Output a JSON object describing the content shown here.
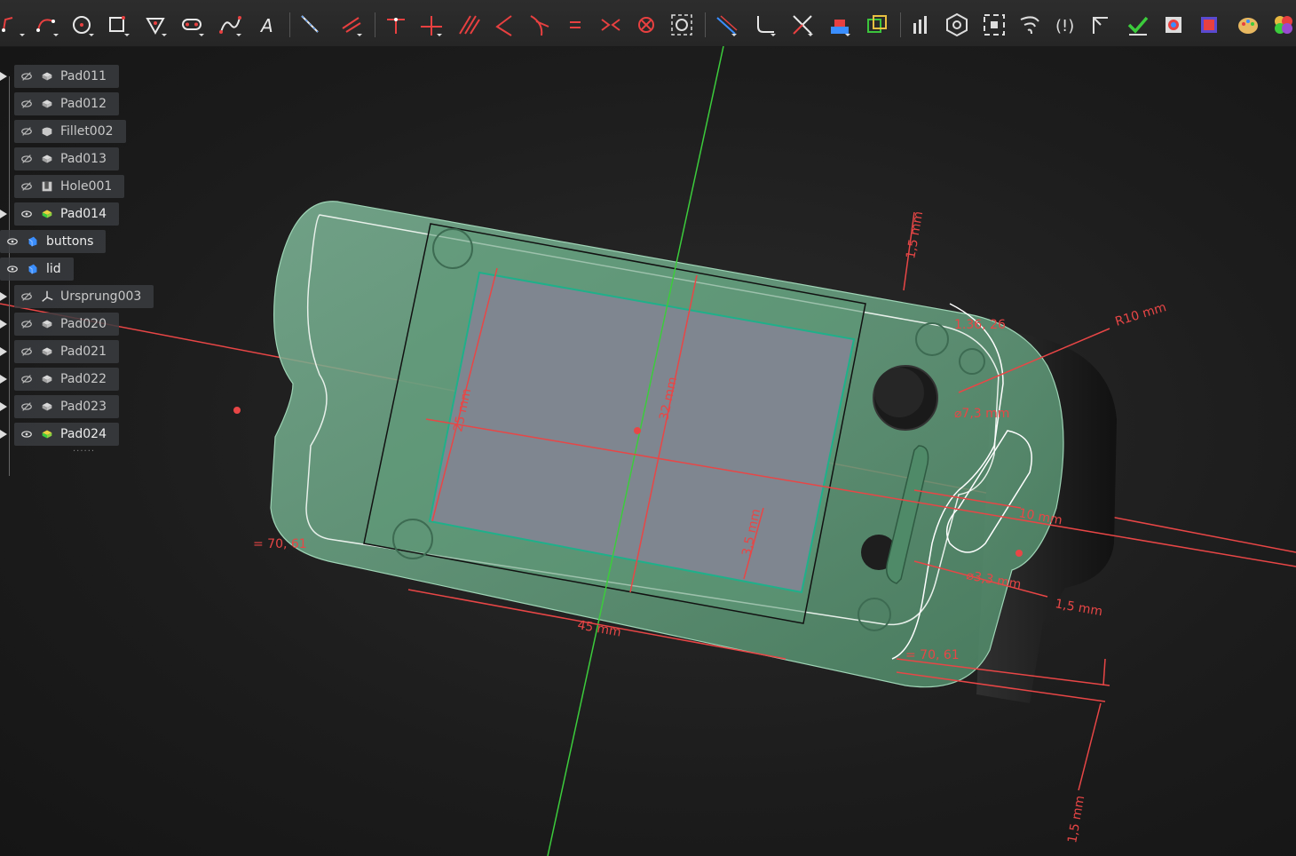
{
  "toolbar": {
    "tools": [
      {
        "name": "polyline-tool",
        "color": "#e84040"
      },
      {
        "name": "arc-tool",
        "color": "#e84040"
      },
      {
        "name": "circle-tool",
        "color": "#e84040"
      },
      {
        "name": "rectangle-tool",
        "color": "#e84040"
      },
      {
        "name": "polygon-tool",
        "color": "#e84040"
      },
      {
        "name": "slot-tool",
        "color": "#e84040"
      },
      {
        "name": "bspline-tool",
        "color": "#e84040"
      },
      {
        "name": "text-tool",
        "color": "#e8e8e8",
        "glyph": "A"
      },
      {
        "name": "line-tool",
        "color": "#e84040"
      },
      {
        "name": "trim-tool",
        "color": "#e84040"
      }
    ]
  },
  "tree": {
    "items": [
      {
        "label": "Pad011",
        "visible": false,
        "icon": "pad",
        "expandable": true
      },
      {
        "label": "Pad012",
        "visible": false,
        "icon": "pad",
        "expandable": false
      },
      {
        "label": "Fillet002",
        "visible": false,
        "icon": "fillet",
        "expandable": false
      },
      {
        "label": "Pad013",
        "visible": false,
        "icon": "pad",
        "expandable": false
      },
      {
        "label": "Hole001",
        "visible": false,
        "icon": "hole",
        "expandable": false
      },
      {
        "label": "Pad014",
        "visible": true,
        "icon": "pad-active",
        "expandable": true
      },
      {
        "label": "buttons",
        "visible": true,
        "icon": "body",
        "expandable": false,
        "root": true
      },
      {
        "label": "lid",
        "visible": true,
        "icon": "body",
        "expandable": false,
        "root": true
      },
      {
        "label": "Ursprung003",
        "visible": false,
        "icon": "origin",
        "expandable": true
      },
      {
        "label": "Pad020",
        "visible": false,
        "icon": "pad",
        "expandable": true
      },
      {
        "label": "Pad021",
        "visible": false,
        "icon": "pad",
        "expandable": true
      },
      {
        "label": "Pad022",
        "visible": false,
        "icon": "pad",
        "expandable": true
      },
      {
        "label": "Pad023",
        "visible": false,
        "icon": "pad",
        "expandable": true
      },
      {
        "label": "Pad024",
        "visible": true,
        "icon": "pad-active",
        "expandable": true
      }
    ],
    "ellipsis": "......"
  },
  "dimensions": {
    "top_thickness": "1,5 mm",
    "radius": "R10 mm",
    "angle_top": "1.36, 26",
    "hole_dia_top": "⌀7,3 mm",
    "width_25": "25 mm",
    "height_32": "32 mm",
    "offset_3_5": "3,5 mm",
    "length_45": "45 mm",
    "ten": "10 mm",
    "hole_dia_bottom": "⌀3,3 mm",
    "side_thickness": "1,5 mm",
    "bottom_thickness": "1,5 mm",
    "equal_left": "= 70, 61",
    "equal_right": "= 70, 61"
  },
  "colors": {
    "accent_red": "#e84646",
    "axis_green": "#3ccc3c",
    "body_green": "#6aa080",
    "screen_gray": "#7f8690"
  }
}
